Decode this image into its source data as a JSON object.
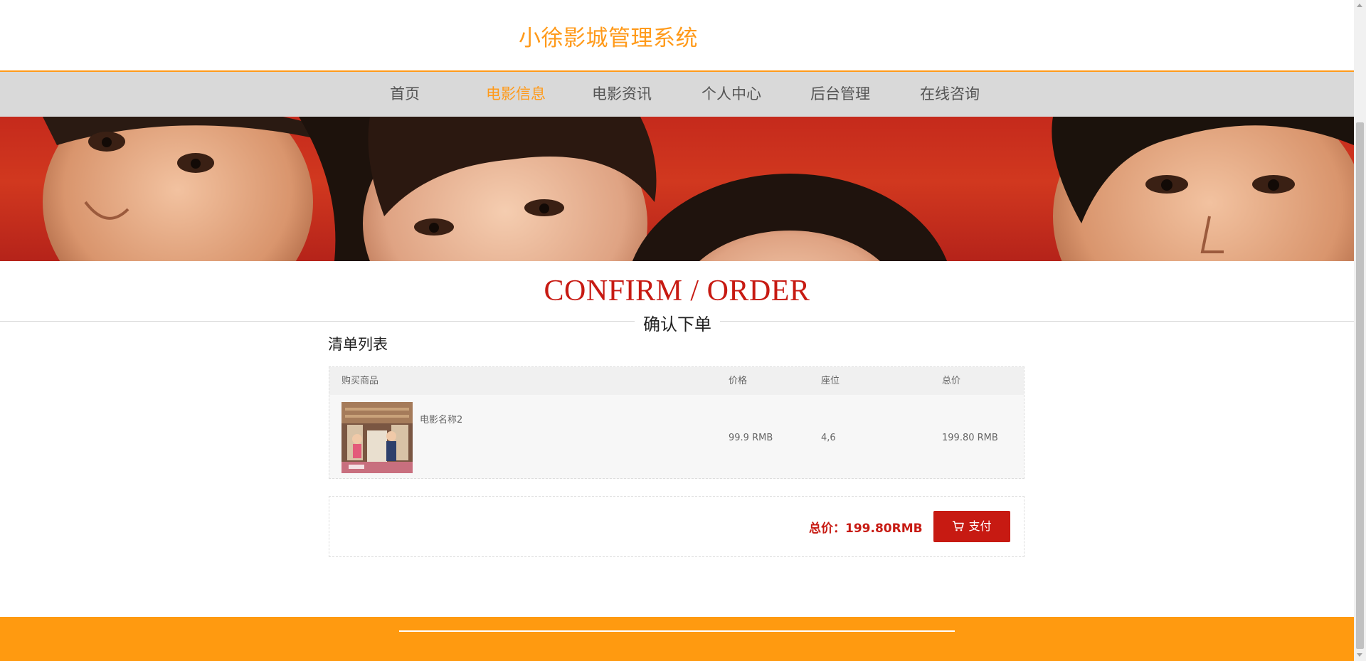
{
  "header": {
    "site_title": "小徐影城管理系统"
  },
  "nav": {
    "items": [
      {
        "label": "首页"
      },
      {
        "label": "电影信息",
        "active": true
      },
      {
        "label": "电影资讯"
      },
      {
        "label": "个人中心"
      },
      {
        "label": "后台管理"
      },
      {
        "label": "在线咨询"
      }
    ]
  },
  "page": {
    "heading_en": "CONFIRM / ORDER",
    "heading_cn": "确认下单",
    "list_title": "清单列表"
  },
  "order_table": {
    "headers": [
      "购买商品",
      "价格",
      "座位",
      "总价"
    ],
    "rows": [
      {
        "movie_name": "电影名称2",
        "price": "99.9 RMB",
        "seats": "4,6",
        "total": "199.80 RMB"
      }
    ]
  },
  "summary": {
    "total_text": "总价：199.80RMB",
    "pay_label": "支付"
  },
  "colors": {
    "accent_orange": "#ff9a1a",
    "primary_red": "#c71a12",
    "nav_bg": "#d9d9d9",
    "footer_orange": "#ff9a10"
  },
  "icons": {
    "pay_button": "cart-icon"
  }
}
